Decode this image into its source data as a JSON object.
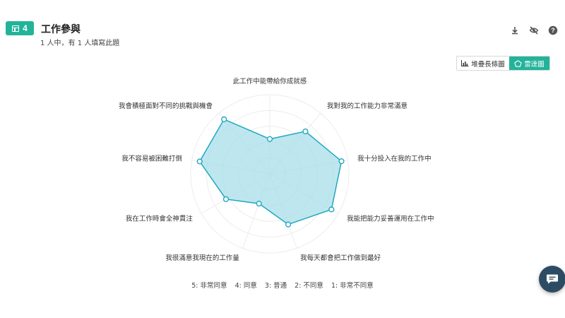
{
  "question": {
    "number": "4",
    "title": "工作參與",
    "subtitle": "1 人中，有 1 人填寫此題"
  },
  "toolbar": {
    "icons": [
      "download-icon",
      "eye-off-icon",
      "help-icon"
    ]
  },
  "view_toggle": {
    "options": [
      {
        "label": "堆疊長條圖",
        "icon": "bar-chart-icon",
        "active": false
      },
      {
        "label": "雷達圖",
        "icon": "radar-chart-icon",
        "active": true
      }
    ]
  },
  "legend": {
    "items": [
      "5: 非常同意",
      "4: 同意",
      "3: 普通",
      "2: 不同意",
      "1: 非常不同意"
    ]
  },
  "colors": {
    "accent": "#22b39a",
    "radar_stroke": "#1fa8bf",
    "radar_fill": "#a8dde8",
    "fab": "#2d4c63"
  },
  "chart_data": {
    "type": "radar",
    "scale_max": 5,
    "rings": 5,
    "categories": [
      "此工作中能帶給你成就感",
      "我對我的工作能力非常滿意",
      "我十分投入在我的工作中",
      "我能把能力妥善運用在工作中",
      "我每天都會把工作做到最好",
      "我很滿意我現在的工作量",
      "我在工作時會全神貫注",
      "我不容易被困難打倒",
      "我會積極面對不同的挑戰與機會"
    ],
    "values": [
      2.2,
      3.5,
      4.6,
      4.5,
      3.4,
      2.0,
      3.2,
      4.5,
      4.5
    ]
  }
}
